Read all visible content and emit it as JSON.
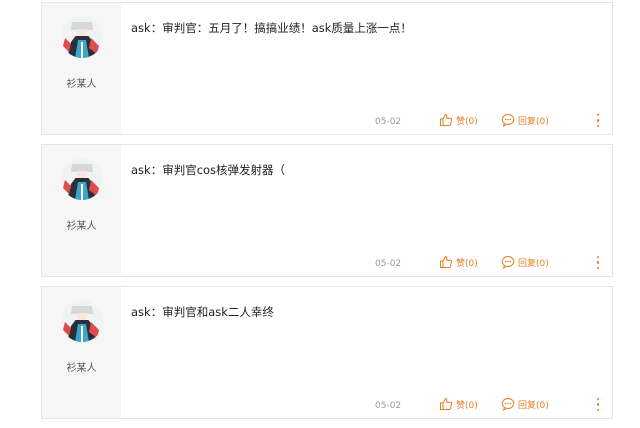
{
  "colors": {
    "accent": "#e67e22",
    "panel": "#f6f6f6",
    "border": "#e6e6e6"
  },
  "comments": [
    {
      "username": "衫某人",
      "text": "ask：审判官：五月了！搞搞业绩！ask质量上涨一点！",
      "date": "05-02",
      "like_label": "赞(0)",
      "reply_label": "回复(0)",
      "like_icon": "thumb-up-icon",
      "reply_icon": "chat-bubble-icon",
      "more_icon": "more-vertical-icon"
    },
    {
      "username": "衫某人",
      "text": "ask：审判官cos核弹发射器（",
      "date": "05-02",
      "like_label": "赞(0)",
      "reply_label": "回复(0)",
      "like_icon": "thumb-up-icon",
      "reply_icon": "chat-bubble-icon",
      "more_icon": "more-vertical-icon"
    },
    {
      "username": "衫某人",
      "text": "ask：审判官和ask二人幸终",
      "date": "05-02",
      "like_label": "赞(0)",
      "reply_label": "回复(0)",
      "like_icon": "thumb-up-icon",
      "reply_icon": "chat-bubble-icon",
      "more_icon": "more-vertical-icon"
    }
  ]
}
